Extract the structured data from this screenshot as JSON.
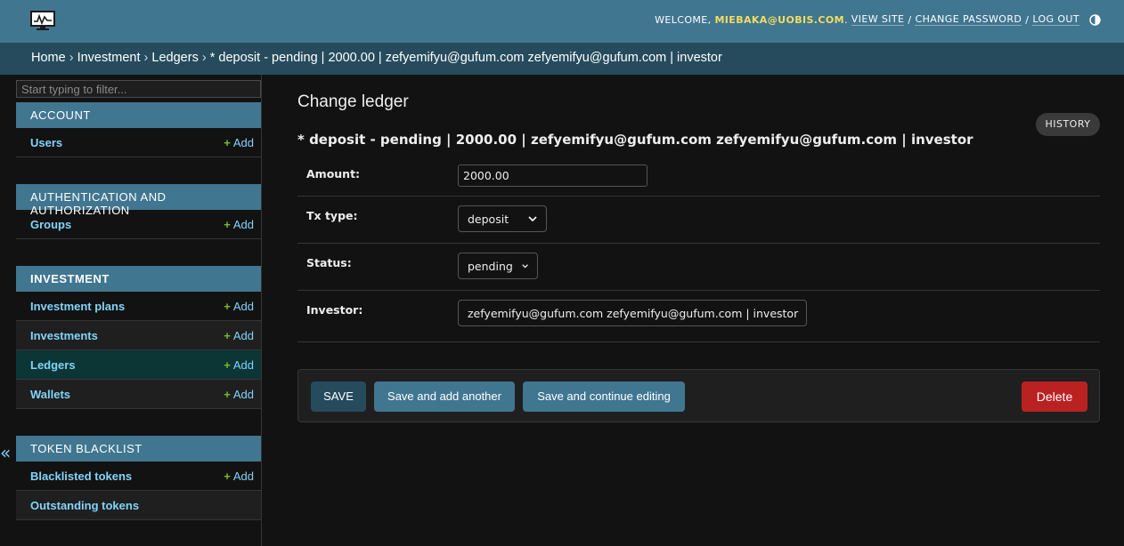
{
  "header": {
    "welcome": "WELCOME,",
    "user_email": "MIEBAKA@UOBIS.COM",
    "user_tail": ".",
    "view_site": "VIEW SITE",
    "change_password": "CHANGE PASSWORD",
    "log_out": "LOG OUT",
    "separator": "/"
  },
  "breadcrumbs": {
    "home": "Home",
    "app": "Investment",
    "model": "Ledgers",
    "current": "* deposit - pending | 2000.00 | zefyemifyu@gufum.com zefyemifyu@gufum.com | investor",
    "sep": "›"
  },
  "sidebar": {
    "filter_placeholder": "Start typing to filter...",
    "add_label": "Add",
    "plus": "+",
    "toggle": "«",
    "modules": [
      {
        "caption": "ACCOUNT",
        "models": [
          {
            "name": "Users"
          }
        ]
      },
      {
        "caption": "AUTHENTICATION AND AUTHORIZATION",
        "models": [
          {
            "name": "Groups"
          }
        ]
      },
      {
        "caption": "INVESTMENT",
        "models": [
          {
            "name": "Investment plans"
          },
          {
            "name": "Investments"
          },
          {
            "name": "Ledgers"
          },
          {
            "name": "Wallets"
          }
        ]
      },
      {
        "caption": "TOKEN BLACKLIST",
        "models": [
          {
            "name": "Blacklisted tokens"
          },
          {
            "name": "Outstanding tokens"
          }
        ]
      }
    ]
  },
  "content": {
    "title": "Change ledger",
    "object_title": "* deposit - pending | 2000.00 | zefyemifyu@gufum.com zefyemifyu@gufum.com | investor",
    "history": "HISTORY",
    "fields": {
      "amount": {
        "label": "Amount:",
        "value": "2000.00"
      },
      "tx_type": {
        "label": "Tx type:",
        "value": "deposit"
      },
      "status": {
        "label": "Status:",
        "value": "pending"
      },
      "investor": {
        "label": "Investor:",
        "value": "zefyemifyu@gufum.com zefyemifyu@gufum.com | investor"
      }
    }
  },
  "submit_row": {
    "save": "SAVE",
    "save_add_another": "Save and add another",
    "save_continue": "Save and continue editing",
    "delete": "Delete"
  },
  "colors": {
    "header_bg": "#417690",
    "breadcrumb_bg": "#264b5d",
    "link": "#81d4fa",
    "add_plus": "#70bf2b",
    "user_highlight": "#f5dd5d",
    "delete_bg": "#ba2121",
    "selected_row_bg": "#0c3535"
  }
}
